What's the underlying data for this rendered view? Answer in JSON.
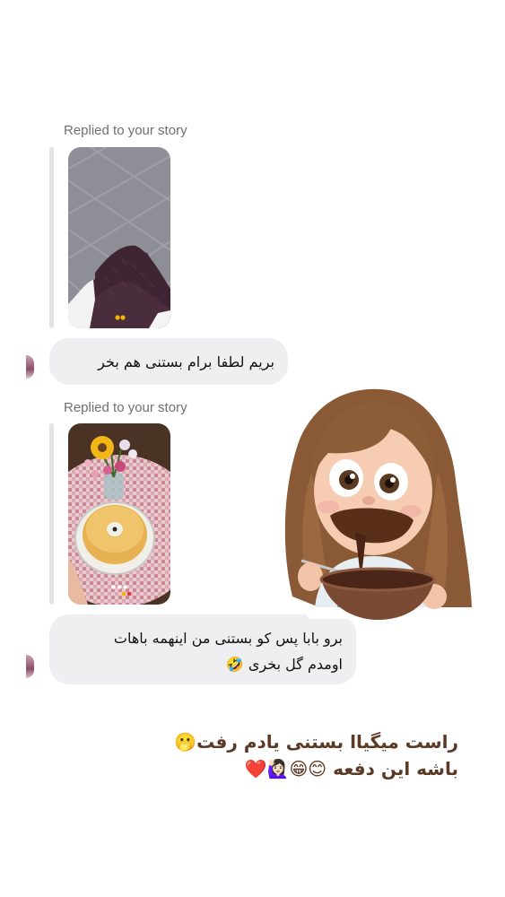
{
  "thread": {
    "messages": [
      {
        "reply_label": "Replied to your story",
        "story_preview": "pavement-legs",
        "text_lines": [
          "بریم لطفا برام بستنی هم بخر"
        ]
      },
      {
        "reply_label": "Replied to your story",
        "story_preview": "cake-flowers",
        "text_lines": [
          "برو بابا پس کو بستنی من اینهمه باهات",
          "اومدم گل بخری 🤣"
        ]
      }
    ]
  },
  "sticker": {
    "icon": "girl-eating-chocolate-sticker"
  },
  "overlay": {
    "lines": [
      "راست میگیاا بستنی یادم رفت🫢",
      "باشه این دفعه 😊😁🙋🏻‍♀️❤️"
    ]
  },
  "colors": {
    "bubble": "#efeff1",
    "reply_label": "#6f6f75",
    "overlay_text": "#5a3a24"
  }
}
